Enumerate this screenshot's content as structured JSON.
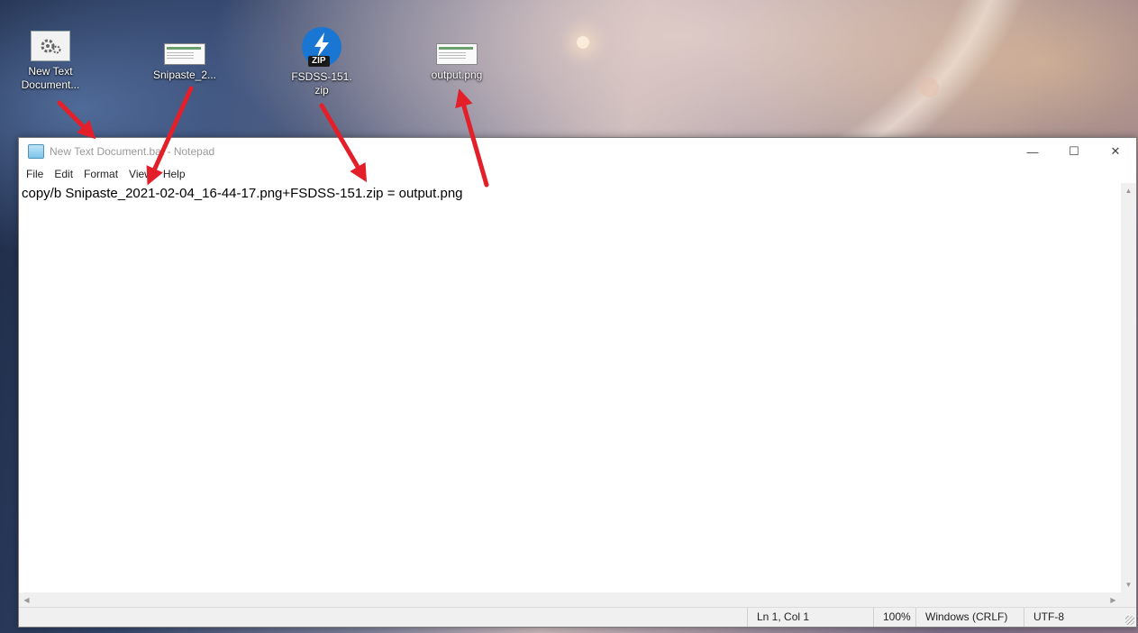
{
  "desktop": {
    "icons": [
      {
        "label": "New Text Document...",
        "icon": "settings-file-icon"
      },
      {
        "label": "Snipaste_2...",
        "icon": "image-file-icon"
      },
      {
        "label": "FSDSS-151.zip",
        "icon": "zip-file-icon",
        "badge": "ZIP"
      },
      {
        "label": "output.png",
        "icon": "image-file-icon"
      }
    ]
  },
  "notepad": {
    "title": "New Text Document.bat - Notepad",
    "controls": {
      "minimize": "—",
      "maximize": "☐",
      "close": "✕"
    },
    "menu": [
      "File",
      "Edit",
      "Format",
      "View",
      "Help"
    ],
    "content": "copy/b Snipaste_2021-02-04_16-44-17.png+FSDSS-151.zip = output.png",
    "status": {
      "position": "Ln 1, Col 1",
      "zoom": "100%",
      "line_ending": "Windows (CRLF)",
      "encoding": "UTF-8"
    }
  },
  "colors": {
    "annotation_arrow": "#e3202a",
    "zip_icon": "#1976d2"
  }
}
